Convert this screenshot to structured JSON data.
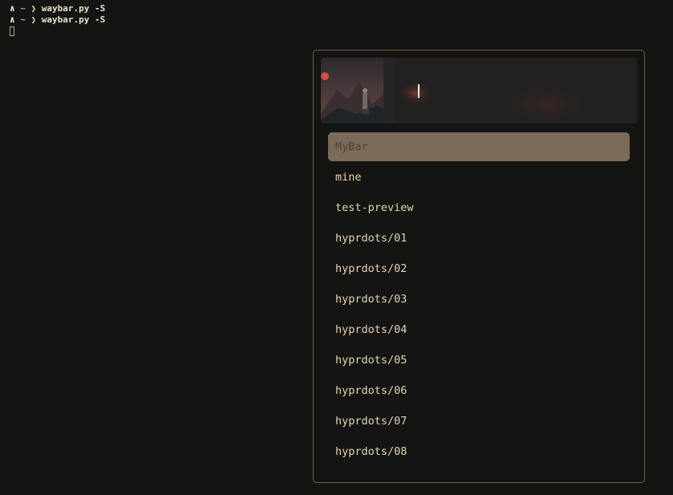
{
  "terminal": {
    "lines": [
      {
        "arrow": "∧",
        "dir": "~",
        "chevron": "❯",
        "command": "waybar.py -S"
      },
      {
        "arrow": "∧",
        "dir": "~",
        "chevron": "❯",
        "command": "waybar.py -S"
      }
    ]
  },
  "launcher": {
    "search": {
      "value": "",
      "placeholder": ""
    },
    "selected_index": 0,
    "items": [
      {
        "label": "MyBar"
      },
      {
        "label": "mine"
      },
      {
        "label": "test-preview"
      },
      {
        "label": "hyprdots/01"
      },
      {
        "label": "hyprdots/02"
      },
      {
        "label": "hyprdots/03"
      },
      {
        "label": "hyprdots/04"
      },
      {
        "label": "hyprdots/05"
      },
      {
        "label": "hyprdots/06"
      },
      {
        "label": "hyprdots/07"
      },
      {
        "label": "hyprdots/08"
      }
    ]
  },
  "colors": {
    "background": "#141412",
    "border": "#6b5c4a",
    "selected_bg": "#7a6a58",
    "item_text": "#e3d6b2",
    "selected_text": "#4e4234",
    "prompt_tilde": "#7fb7c7"
  }
}
